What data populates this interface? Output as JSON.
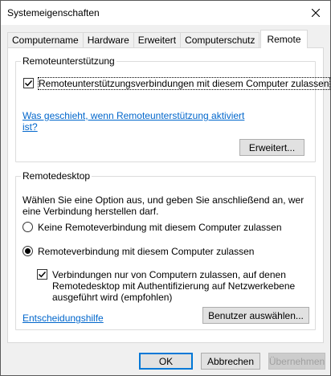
{
  "window": {
    "title": "Systemeigenschaften"
  },
  "tabs": [
    {
      "label": "Computername",
      "active": false
    },
    {
      "label": "Hardware",
      "active": false
    },
    {
      "label": "Erweitert",
      "active": false
    },
    {
      "label": "Computerschutz",
      "active": false
    },
    {
      "label": "Remote",
      "active": true
    }
  ],
  "remote_assistance": {
    "group_title": "Remoteunterstützung",
    "allow_checkbox": {
      "label": "Remoteunterstützungsverbindungen mit diesem Computer zulassen",
      "checked": true
    },
    "help_link_line1": "Was geschieht, wenn Remoteunterstützung aktiviert",
    "help_link_line2": "ist?",
    "advanced_button": "Erweitert..."
  },
  "remote_desktop": {
    "group_title": "Remotedesktop",
    "intro_line1": "Wählen Sie eine Option aus, und geben Sie anschließend an, wer",
    "intro_line2": "eine Verbindung herstellen darf.",
    "option_none": {
      "label": "Keine Remoteverbindung mit diesem Computer zulassen",
      "selected": false
    },
    "option_allow": {
      "label": "Remoteverbindung mit diesem Computer zulassen",
      "selected": true
    },
    "nla_checkbox": {
      "line1": "Verbindungen nur von Computern zulassen, auf denen",
      "line2": "Remotedesktop mit Authentifizierung auf Netzwerkebene",
      "line3": "ausgeführt wird (empfohlen)",
      "checked": true
    },
    "help_link": "Entscheidungshilfe",
    "select_users_button": "Benutzer auswählen..."
  },
  "footer": {
    "ok": "OK",
    "cancel": "Abbrechen",
    "apply": "Übernehmen"
  }
}
